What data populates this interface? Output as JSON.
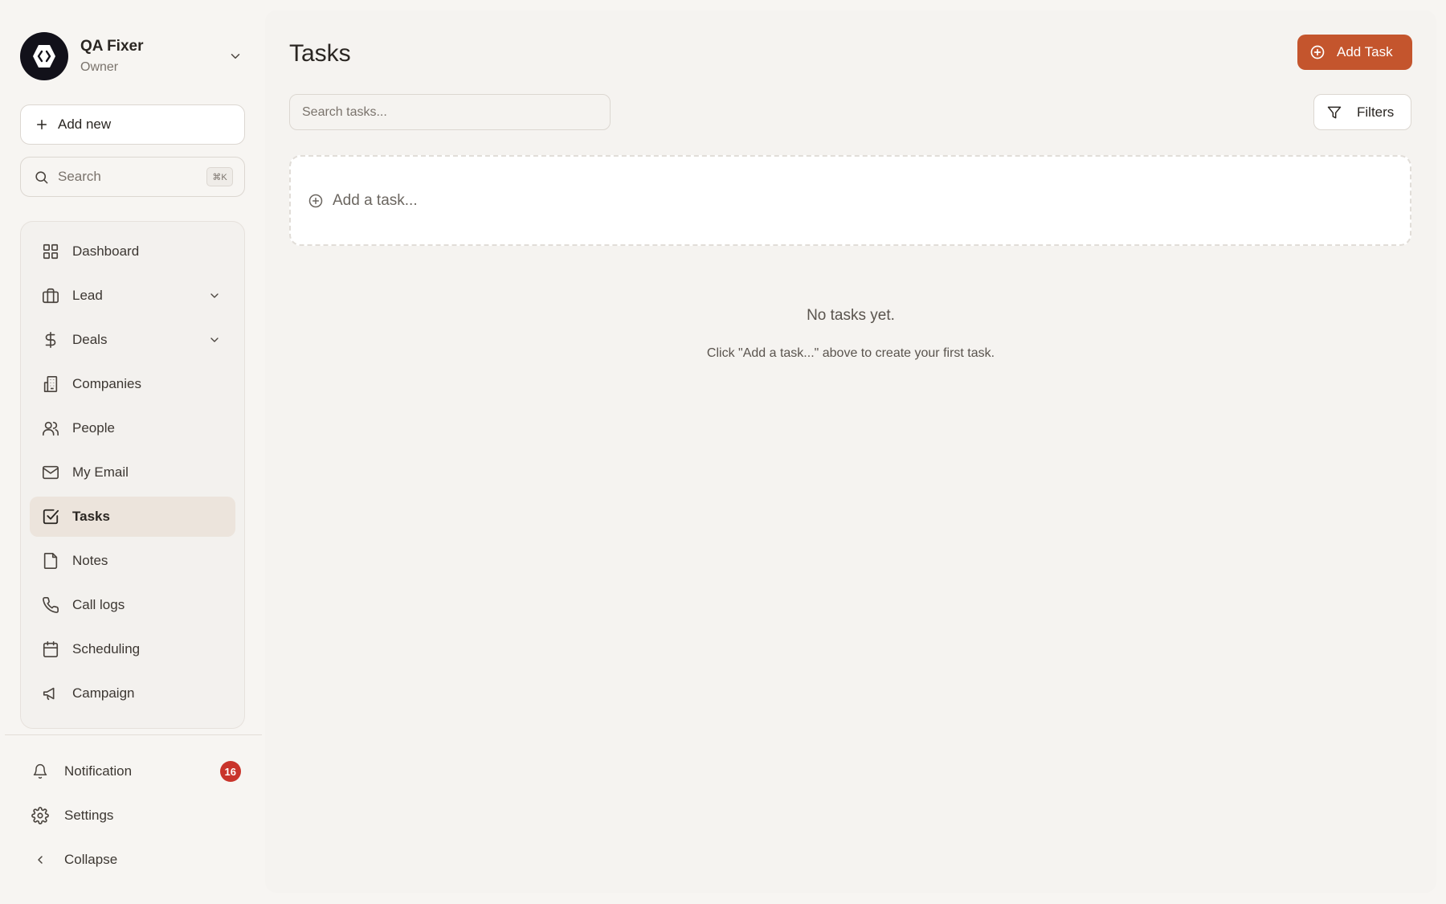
{
  "account": {
    "name": "QA Fixer",
    "role": "Owner"
  },
  "sidebar": {
    "add_new_label": "Add new",
    "search_label": "Search",
    "search_shortcut": "⌘K",
    "items": [
      {
        "label": "Dashboard",
        "icon": "grid-icon"
      },
      {
        "label": "Lead",
        "icon": "briefcase-icon",
        "expandable": true
      },
      {
        "label": "Deals",
        "icon": "dollar-icon",
        "expandable": true
      },
      {
        "label": "Companies",
        "icon": "building-icon"
      },
      {
        "label": "People",
        "icon": "users-icon"
      },
      {
        "label": "My Email",
        "icon": "mail-icon"
      },
      {
        "label": "Tasks",
        "icon": "check-square-icon",
        "active": true
      },
      {
        "label": "Notes",
        "icon": "note-icon"
      },
      {
        "label": "Call logs",
        "icon": "phone-icon"
      },
      {
        "label": "Scheduling",
        "icon": "calendar-icon"
      },
      {
        "label": "Campaign",
        "icon": "megaphone-icon"
      }
    ],
    "bottom": {
      "notification_label": "Notification",
      "notification_count": "16",
      "settings_label": "Settings",
      "collapse_label": "Collapse"
    }
  },
  "main": {
    "title": "Tasks",
    "add_task_label": "Add Task",
    "search_placeholder": "Search tasks...",
    "filters_label": "Filters",
    "add_row_label": "Add a task...",
    "empty_title": "No tasks yet.",
    "empty_subtitle": "Click \"Add a task...\" above to create your first task."
  },
  "colors": {
    "accent": "#c4552d",
    "badge": "#c9342b",
    "active_nav": "#ece4dc"
  }
}
